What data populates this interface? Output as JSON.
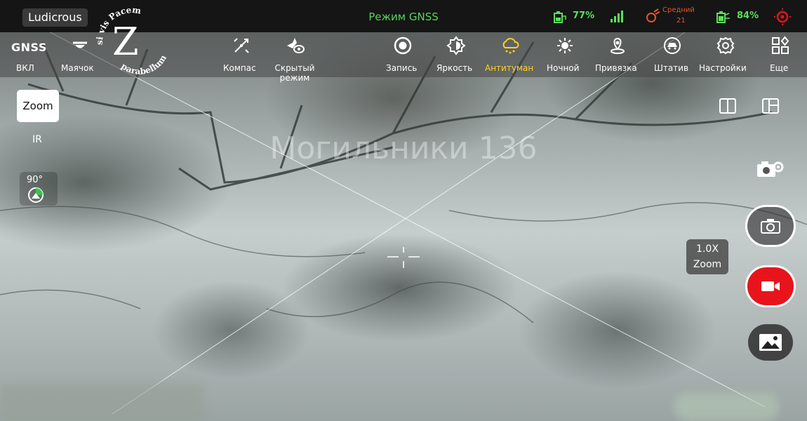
{
  "status_bar": {
    "ludicrous_label": "Ludicrous",
    "flight_mode": "Режим GNSS",
    "remote_battery": "77%",
    "signal_text": "ᴿᶜ",
    "gps_level": "Средний",
    "satellite_count": "21",
    "drone_battery": "84%"
  },
  "logo": {
    "top_text": "si vis Pacem",
    "bottom_text": "parabellum",
    "letter": "Z"
  },
  "toolbar": {
    "gnss_title": "GNSS",
    "gnss_state": "ВКЛ",
    "items": [
      {
        "label": "Маячок",
        "icon": "beacon-icon"
      },
      {
        "label": "Компас",
        "icon": "compass-icon"
      },
      {
        "label": "Скрытый режим",
        "icon": "stealth-mode-icon"
      },
      {
        "label": "Запись",
        "icon": "record-icon"
      },
      {
        "label": "Яркость",
        "icon": "brightness-icon"
      },
      {
        "label": "Антитуман",
        "icon": "defog-icon",
        "active": true
      },
      {
        "label": "Ночной",
        "icon": "night-mode-icon"
      },
      {
        "label": "Привязка",
        "icon": "anchor-pin-icon"
      },
      {
        "label": "Штатив",
        "icon": "tripod-icon"
      },
      {
        "label": "Настройки",
        "icon": "gear-icon"
      },
      {
        "label": "Еще",
        "icon": "more-grid-icon"
      }
    ],
    "active_color": "#ffd21f"
  },
  "left_panel": {
    "zoom_label": "Zoom",
    "ir_label": "IR",
    "gimbal_angle": "90°"
  },
  "camera": {
    "zoom_value": "1.0X",
    "zoom_caption": "Zoom",
    "record_color": "#e8141c"
  },
  "overlay": {
    "watermark": "Могильники 136"
  }
}
